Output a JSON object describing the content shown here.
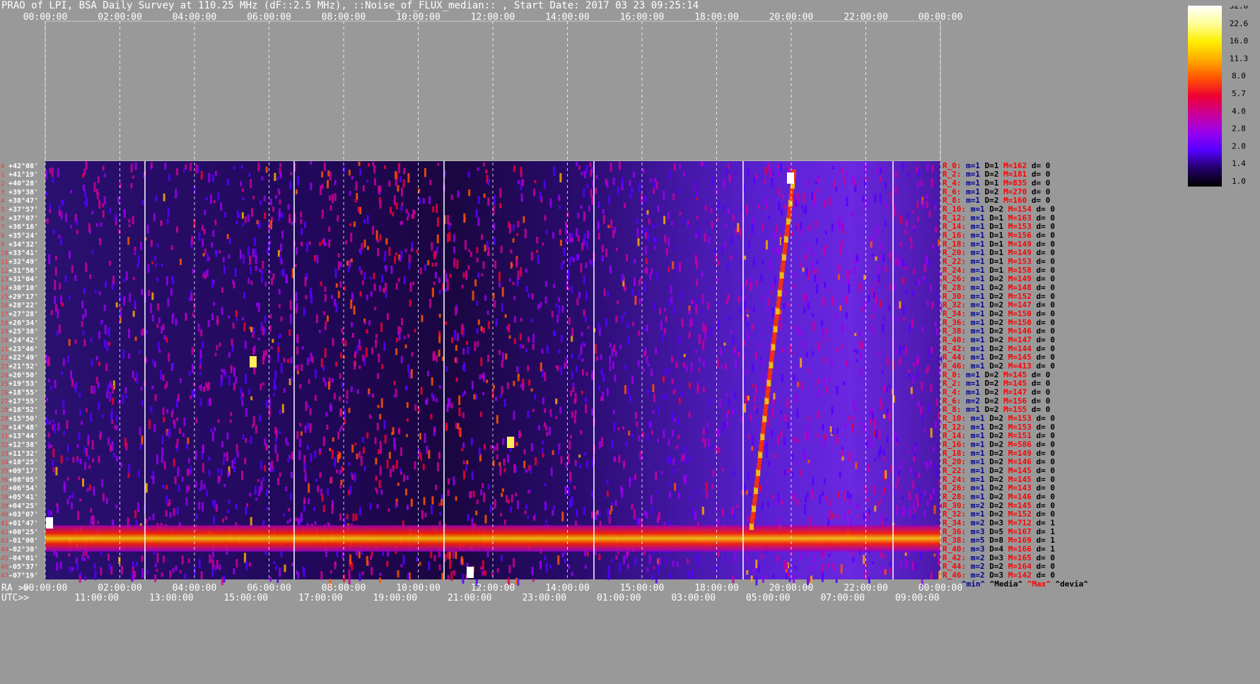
{
  "title": "PRAO of LPI, BSA Daily Survey at 110.25 MHz (dF::2.5 MHz), ::Noise_of_FLUX_median:: , Start Date: 2017 03 23 09:25:14",
  "chart_data": {
    "type": "heatmap",
    "title": "PRAO of LPI, BSA Daily Survey at 110.25 MHz (dF::2.5 MHz), ::Noise_of_FLUX_median:: , Start Date: 2017 03 23 09:25:14",
    "x_top_ticks": [
      "00:00:00",
      "02:00:00",
      "04:00:00",
      "06:00:00",
      "08:00:00",
      "10:00:00",
      "12:00:00",
      "14:00:00",
      "16:00:00",
      "18:00:00",
      "20:00:00",
      "22:00:00",
      "00:00:00"
    ],
    "x_ra_ticks": [
      "00:00:00",
      "02:00:00",
      "04:00:00",
      "06:00:00",
      "08:00:00",
      "10:00:00",
      "12:00:00",
      "14:00:00",
      "15:00:00",
      "18:00:00",
      "20:00:00",
      "22:00:00",
      "00:00:00"
    ],
    "x_utc_ticks": [
      "11:00:00",
      "13:00:00",
      "15:00:00",
      "17:00:00",
      "19:00:00",
      "21:00:00",
      "23:00:00",
      "01:00:00",
      "03:00:00",
      "05:00:00",
      "07:00:00",
      "09:00:00"
    ],
    "ra_label": "RA >>",
    "utc_label": "UTC>>",
    "declinations": [
      "+42°08'",
      "+41°19'",
      "+40°28'",
      "+39°38'",
      "+38°47'",
      "+37°57'",
      "+37°07'",
      "+36°16'",
      "+35°24'",
      "+34°32'",
      "+33°41'",
      "+32°49'",
      "+31°56'",
      "+31°04'",
      "+30°10'",
      "+29°17'",
      "+28°22'",
      "+27°28'",
      "+26°34'",
      "+25°38'",
      "+24°42'",
      "+23°46'",
      "+22°49'",
      "+21°52'",
      "+20°50'",
      "+19°53'",
      "+18°55'",
      "+17°55'",
      "+16°52'",
      "+15°50'",
      "+14°48'",
      "+13°44'",
      "+12°38'",
      "+11°32'",
      "+10°25'",
      "+09°17'",
      "+08°05'",
      "+06°54'",
      "+05°41'",
      "+04°25'",
      "+03°07'",
      "+01°47'",
      "+00°25'",
      "-01°00'",
      "-02°30'",
      "-04°01'",
      "-05°37'",
      "-07°19'"
    ],
    "colorbar": {
      "ticks": [
        "32.0",
        "22.6",
        "16.0",
        "11.3",
        "8.0",
        "5.7",
        "4.0",
        "2.8",
        "2.0",
        "1.4",
        "1.0"
      ],
      "colors": [
        "#ffffff",
        "#ffff99",
        "#ffee00",
        "#ffaa00",
        "#ff5500",
        "#ee0033",
        "#cc0099",
        "#9900ee",
        "#5500ff",
        "#220066",
        "#000000"
      ]
    },
    "stats_legend": {
      "min": "^min^",
      "media": "^Media^",
      "max": "^Max^",
      "devia": "^devia^"
    },
    "stats": [
      {
        "r": "R_0:",
        "m": "m=1",
        "D": "D=1",
        "M": "M=162",
        "d": "d= 0"
      },
      {
        "r": "R_2:",
        "m": "m=1",
        "D": "D=2",
        "M": "M=181",
        "d": "d= 0"
      },
      {
        "r": "R_4:",
        "m": "m=1",
        "D": "D=1",
        "M": "M=835",
        "d": "d= 0"
      },
      {
        "r": "R_6:",
        "m": "m=1",
        "D": "D=2",
        "M": "M=270",
        "d": "d= 0"
      },
      {
        "r": "R_8:",
        "m": "m=1",
        "D": "D=2",
        "M": "M=160",
        "d": "d= 0"
      },
      {
        "r": "R_10:",
        "m": "m=1",
        "D": "D=2",
        "M": "M=154",
        "d": "d= 0"
      },
      {
        "r": "R_12:",
        "m": "m=1",
        "D": "D=1",
        "M": "M=163",
        "d": "d= 0"
      },
      {
        "r": "R_14:",
        "m": "m=1",
        "D": "D=1",
        "M": "M=153",
        "d": "d= 0"
      },
      {
        "r": "R_16:",
        "m": "m=1",
        "D": "D=1",
        "M": "M=156",
        "d": "d= 0"
      },
      {
        "r": "R_18:",
        "m": "m=1",
        "D": "D=1",
        "M": "M=149",
        "d": "d= 0"
      },
      {
        "r": "R_20:",
        "m": "m=1",
        "D": "D=1",
        "M": "M=149",
        "d": "d= 0"
      },
      {
        "r": "R_22:",
        "m": "m=1",
        "D": "D=1",
        "M": "M=153",
        "d": "d= 0"
      },
      {
        "r": "R_24:",
        "m": "m=1",
        "D": "D=1",
        "M": "M=158",
        "d": "d= 0"
      },
      {
        "r": "R_26:",
        "m": "m=1",
        "D": "D=2",
        "M": "M=149",
        "d": "d= 0"
      },
      {
        "r": "R_28:",
        "m": "m=1",
        "D": "D=2",
        "M": "M=148",
        "d": "d= 0"
      },
      {
        "r": "R_30:",
        "m": "m=1",
        "D": "D=2",
        "M": "M=152",
        "d": "d= 0"
      },
      {
        "r": "R_32:",
        "m": "m=1",
        "D": "D=2",
        "M": "M=147",
        "d": "d= 0"
      },
      {
        "r": "R_34:",
        "m": "m=1",
        "D": "D=2",
        "M": "M=150",
        "d": "d= 0"
      },
      {
        "r": "R_36:",
        "m": "m=1",
        "D": "D=2",
        "M": "M=150",
        "d": "d= 0"
      },
      {
        "r": "R_38:",
        "m": "m=1",
        "D": "D=2",
        "M": "M=146",
        "d": "d= 0"
      },
      {
        "r": "R_40:",
        "m": "m=1",
        "D": "D=2",
        "M": "M=147",
        "d": "d= 0"
      },
      {
        "r": "R_42:",
        "m": "m=1",
        "D": "D=2",
        "M": "M=144",
        "d": "d= 0"
      },
      {
        "r": "R_44:",
        "m": "m=1",
        "D": "D=2",
        "M": "M=145",
        "d": "d= 0"
      },
      {
        "r": "R_46:",
        "m": "m=1",
        "D": "D=2",
        "M": "M=413",
        "d": "d= 0"
      },
      {
        "r": "R_0:",
        "m": "m=1",
        "D": "D=2",
        "M": "M=145",
        "d": "d= 0"
      },
      {
        "r": "R_2:",
        "m": "m=1",
        "D": "D=2",
        "M": "M=145",
        "d": "d= 0"
      },
      {
        "r": "R_4:",
        "m": "m=1",
        "D": "D=2",
        "M": "M=147",
        "d": "d= 0"
      },
      {
        "r": "R_6:",
        "m": "m=2",
        "D": "D=2",
        "M": "M=156",
        "d": "d= 0"
      },
      {
        "r": "R_8:",
        "m": "m=1",
        "D": "D=2",
        "M": "M=155",
        "d": "d= 0"
      },
      {
        "r": "R_10:",
        "m": "m=1",
        "D": "D=2",
        "M": "M=153",
        "d": "d= 0"
      },
      {
        "r": "R_12:",
        "m": "m=1",
        "D": "D=2",
        "M": "M=153",
        "d": "d= 0"
      },
      {
        "r": "R_14:",
        "m": "m=1",
        "D": "D=2",
        "M": "M=151",
        "d": "d= 0"
      },
      {
        "r": "R_16:",
        "m": "m=1",
        "D": "D=2",
        "M": "M=586",
        "d": "d= 0"
      },
      {
        "r": "R_18:",
        "m": "m=1",
        "D": "D=2",
        "M": "M=149",
        "d": "d= 0"
      },
      {
        "r": "R_20:",
        "m": "m=1",
        "D": "D=2",
        "M": "M=146",
        "d": "d= 0"
      },
      {
        "r": "R_22:",
        "m": "m=1",
        "D": "D=2",
        "M": "M=145",
        "d": "d= 0"
      },
      {
        "r": "R_24:",
        "m": "m=1",
        "D": "D=2",
        "M": "M=145",
        "d": "d= 0"
      },
      {
        "r": "R_26:",
        "m": "m=1",
        "D": "D=2",
        "M": "M=143",
        "d": "d= 0"
      },
      {
        "r": "R_28:",
        "m": "m=1",
        "D": "D=2",
        "M": "M=146",
        "d": "d= 0"
      },
      {
        "r": "R_30:",
        "m": "m=2",
        "D": "D=2",
        "M": "M=145",
        "d": "d= 0"
      },
      {
        "r": "R_32:",
        "m": "m=1",
        "D": "D=2",
        "M": "M=152",
        "d": "d= 0"
      },
      {
        "r": "R_34:",
        "m": "m=2",
        "D": "D=3",
        "M": "M=712",
        "d": "d= 1"
      },
      {
        "r": "R_36:",
        "m": "m=3",
        "D": "D=5",
        "M": "M=167",
        "d": "d= 1"
      },
      {
        "r": "R_38:",
        "m": "m=5",
        "D": "D=8",
        "M": "M=169",
        "d": "d= 1"
      },
      {
        "r": "R_40:",
        "m": "m=3",
        "D": "D=4",
        "M": "M=166",
        "d": "d= 1"
      },
      {
        "r": "R_42:",
        "m": "m=2",
        "D": "D=3",
        "M": "M=165",
        "d": "d= 0"
      },
      {
        "r": "R_44:",
        "m": "m=2",
        "D": "D=2",
        "M": "M=164",
        "d": "d= 0"
      },
      {
        "r": "R_46:",
        "m": "m=2",
        "D": "D=3",
        "M": "M=142",
        "d": "d= 0"
      }
    ]
  },
  "colors": {
    "background": "#999999",
    "stat_label": "#ff0000",
    "stat_m": "#000099",
    "stat_D": "#000000",
    "stat_M": "#ff0000",
    "stat_d": "#000000",
    "white": "#ffffff"
  }
}
